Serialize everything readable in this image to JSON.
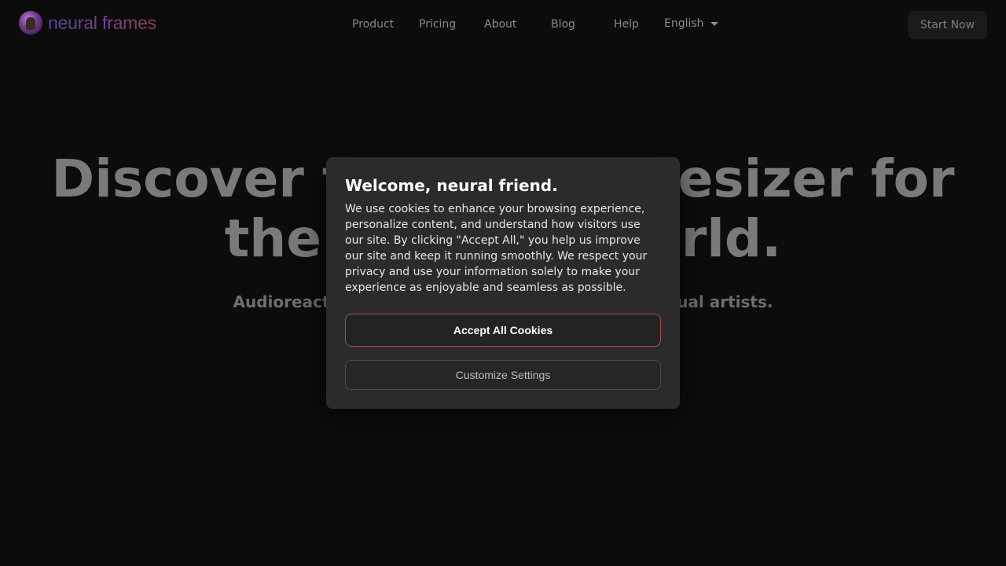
{
  "header": {
    "logo_text": "neural frames",
    "nav": {
      "product": "Product",
      "pricing": "Pricing",
      "about": "About",
      "blog": "Blog",
      "help": "Help",
      "language": "English"
    },
    "cta_label": "Start Now"
  },
  "hero": {
    "title_line1": "Discover the AI synthesizer for",
    "title_line2": "the physical world.",
    "subtitle": "Audioreactive AI animations for musicians and visual artists."
  },
  "cookie_modal": {
    "title": "Welcome, neural friend.",
    "body": "We use cookies to enhance your browsing experience, personalize content, and understand how visitors use our site. By clicking \"Accept All,\" you help us improve our site and keep it running smoothly. We respect your privacy and use your information solely to make your experience as enjoyable and seamless as possible.",
    "accept_label": "Accept All Cookies",
    "customize_label": "Customize Settings"
  },
  "colors": {
    "background": "#0c0c0c",
    "modal_bg": "#2b2b2b",
    "accept_border": "#a8504f"
  }
}
